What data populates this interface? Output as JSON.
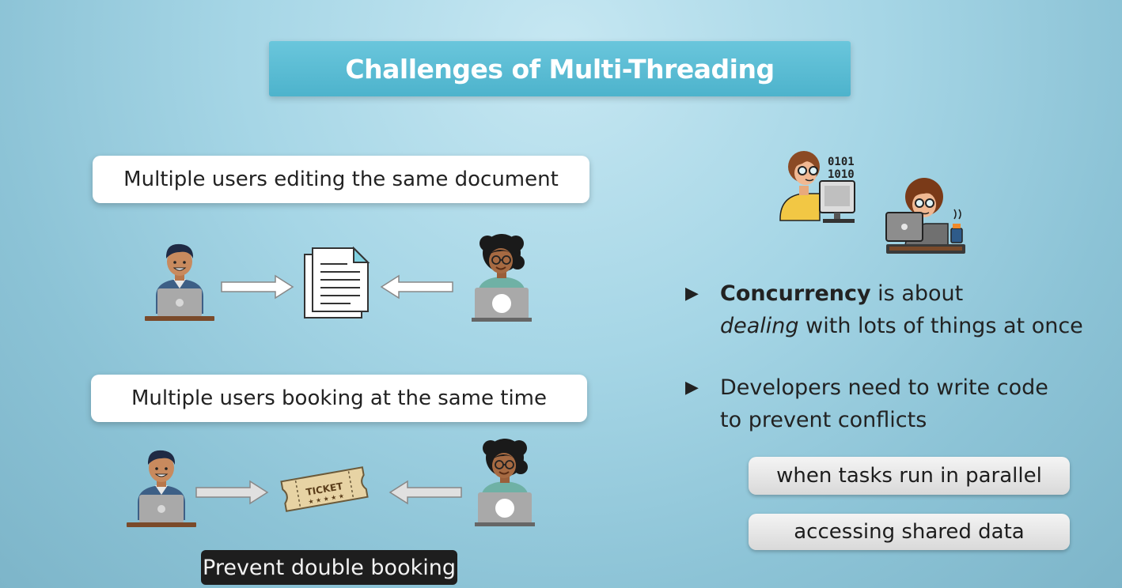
{
  "title": "Challenges of Multi-Threading",
  "scenario1": {
    "label": "Multiple users editing the same document"
  },
  "scenario2": {
    "label": "Multiple users booking at the same time",
    "ticket_text": "TICKET"
  },
  "caption": "Prevent double booking",
  "bullets": [
    {
      "bold": "Concurrency",
      "rest": " is about",
      "line2_italic": "dealing",
      "line2_rest": " with lots of things at once"
    },
    {
      "line1": "Developers need to write code",
      "line2": "to prevent conflicts"
    }
  ],
  "pills": [
    "when tasks run in parallel",
    "accessing shared data"
  ],
  "icon_labels": {
    "binary": "0101",
    "binary2": "1010"
  },
  "colors": {
    "accent": "#4db3cc",
    "skin": "#c88a5e",
    "laptop": "#a9a9a9",
    "shirt_blue": "#3d5f86"
  }
}
